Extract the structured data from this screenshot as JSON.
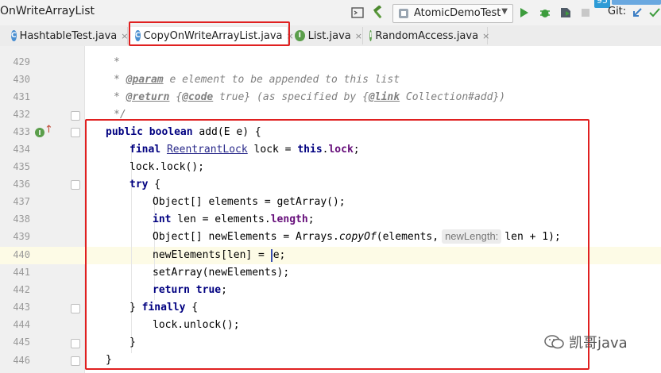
{
  "window": {
    "title": "OnWriteArrayList",
    "run_config": "AtomicDemoTest",
    "git_label": "Git:",
    "badge": "95"
  },
  "tabs": [
    {
      "label": "HashtableTest.java",
      "icon": "C",
      "icon_color": "#4a8fd1",
      "active": false
    },
    {
      "label": "CopyOnWriteArrayList.java",
      "icon": "C",
      "icon_color": "#4a8fd1",
      "active": true
    },
    {
      "label": "List.java",
      "icon": "I",
      "icon_color": "#5b9e4b",
      "active": false
    },
    {
      "label": "RandomAccess.java",
      "icon": "I",
      "icon_color": "#5b9e4b",
      "active": false
    }
  ],
  "code": {
    "line_numbers": [
      "429",
      "430",
      "431",
      "432",
      "433",
      "434",
      "435",
      "436",
      "437",
      "438",
      "439",
      "440",
      "441",
      "442",
      "443",
      "444",
      "445",
      "446"
    ],
    "current_line": "440",
    "hint_label": "newLength:",
    "lines": {
      "l429": "*",
      "l430a": "* ",
      "l430b": "@param",
      "l430c": " e element to be appended to this list",
      "l431a": "* ",
      "l431b": "@return",
      "l431c": " {",
      "l431d": "@code",
      "l431e": " true} (as specified by {",
      "l431f": "@link",
      "l431g": " Collection#add})",
      "l432": "*/",
      "l433a": "public boolean",
      "l433b": " add(E e) {",
      "l434a": "final ",
      "l434b": "ReentrantLock",
      "l434c": " lock = ",
      "l434d": "this",
      "l434e": ".",
      "l434f": "lock",
      "l434g": ";",
      "l435": "lock.lock();",
      "l436a": "try",
      "l436b": " {",
      "l437": "Object[] elements = getArray();",
      "l438a": "int",
      "l438b": " len = elements.",
      "l438c": "length",
      "l438d": ";",
      "l439a": "Object[] newElements = Arrays.",
      "l439b": "copyOf",
      "l439c": "(elements,",
      "l439d": "len + 1);",
      "l440a": "newElements[len] = ",
      "l440b": "e;",
      "l441": "setArray(newElements);",
      "l442a": "return true",
      "l442b": ";",
      "l443a": "} ",
      "l443b": "finally",
      "l443c": " {",
      "l444": "lock.unlock();",
      "l445": "}",
      "l446": "}"
    }
  },
  "watermark": "凯哥java",
  "colors": {
    "highlight_border": "#e02020",
    "keyword": "#000080",
    "comment": "#808080",
    "field": "#660e7a"
  }
}
